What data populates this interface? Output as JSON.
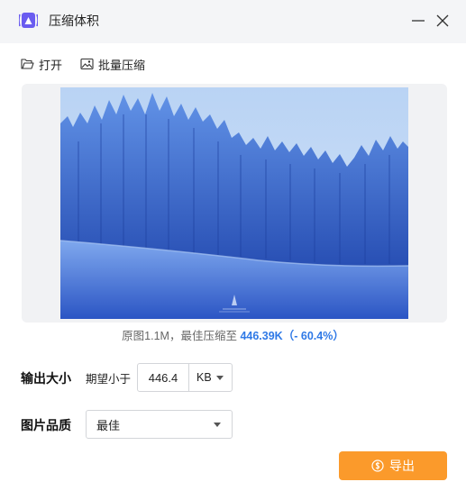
{
  "window": {
    "title": "压缩体积",
    "icon": "app-logo-icon",
    "controls": {
      "minimize_icon": "minimize-icon",
      "close_icon": "close-icon"
    }
  },
  "toolbar": {
    "open_label": "打开",
    "open_icon": "folder-open-icon",
    "batch_label": "批量压缩",
    "batch_icon": "image-icon"
  },
  "preview": {
    "image_description": "snowy forest photo"
  },
  "summary": {
    "original_prefix": "原图",
    "original_size": "1.1M",
    "separator": "，",
    "best_prefix": "最佳压缩至 ",
    "best_size": "446.39K",
    "open_paren": "（",
    "change": "- 60.4%",
    "close_paren": "）"
  },
  "output_size": {
    "label": "输出大小",
    "expect_label": "期望小于",
    "value": "446.4",
    "unit": "KB"
  },
  "quality": {
    "label": "图片品质",
    "value": "最佳"
  },
  "export": {
    "label": "导出",
    "icon": "export-coin-icon"
  },
  "colors": {
    "accent": "#2f79e6",
    "export_button": "#fb9a2b",
    "titlebar_bg": "#f4f5f7",
    "app_icon": "#6a5cf0"
  }
}
